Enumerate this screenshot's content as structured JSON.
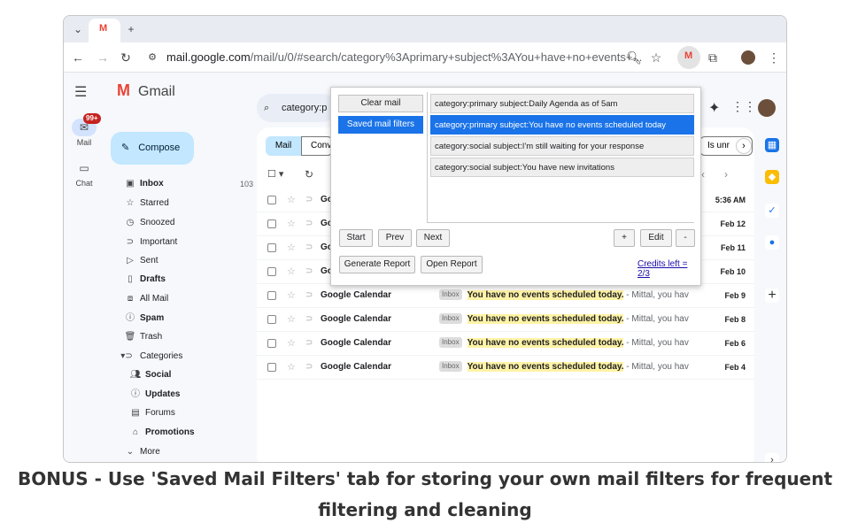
{
  "browser": {
    "url_host": "mail.google.com",
    "url_path": "/mail/u/0/#search/category%3Aprimary+subject%3AYou+have+no+events+...",
    "tab_icon_label": "M"
  },
  "app": {
    "name": "Gmail",
    "search_text": "category:p",
    "compose_label": "Compose",
    "rail": [
      {
        "label": "Mail",
        "badge": "99+"
      },
      {
        "label": "Chat"
      }
    ]
  },
  "nav": [
    {
      "label": "Inbox",
      "count": "103",
      "bold": true,
      "icon": "inbox-icon"
    },
    {
      "label": "Starred",
      "icon": "star-icon"
    },
    {
      "label": "Snoozed",
      "icon": "clock-icon"
    },
    {
      "label": "Important",
      "icon": "important-icon"
    },
    {
      "label": "Sent",
      "icon": "send-icon"
    },
    {
      "label": "Drafts",
      "bold": true,
      "icon": "draft-icon"
    },
    {
      "label": "All Mail",
      "icon": "all-mail-icon"
    },
    {
      "label": "Spam",
      "bold": true,
      "icon": "spam-icon"
    },
    {
      "label": "Trash",
      "icon": "trash-icon"
    },
    {
      "label": "Categories",
      "icon": "label-icon"
    },
    {
      "label": "Social",
      "bold": true,
      "icon": "social-icon"
    },
    {
      "label": "Updates",
      "bold": true,
      "icon": "info-icon"
    },
    {
      "label": "Forums",
      "icon": "forum-icon"
    },
    {
      "label": "Promotions",
      "bold": true,
      "icon": "tag-icon"
    },
    {
      "label": "More",
      "icon": "chevron-down-icon"
    }
  ],
  "chips": {
    "mail": "Mail",
    "conv": "Conv",
    "unread": "Is unr"
  },
  "rows": [
    {
      "sender": "Go",
      "date": "5:36 AM"
    },
    {
      "sender": "Go",
      "date": "Feb 12"
    },
    {
      "sender": "Go",
      "date": "Feb 11"
    },
    {
      "sender": "Go",
      "date": "Feb 10"
    },
    {
      "sender": "Google Calendar",
      "tag": "Inbox",
      "snippet": "- Mittal, you hav...",
      "date": "Feb 9"
    },
    {
      "sender": "Google Calendar",
      "tag": "Inbox",
      "snippet": "- Mittal, you hav...",
      "date": "Feb 8"
    },
    {
      "sender": "Google Calendar",
      "tag": "Inbox",
      "snippet": "- Mittal, you hav...",
      "date": "Feb 6"
    },
    {
      "sender": "Google Calendar",
      "tag": "Inbox",
      "snippet": "- Mittal, you hav...",
      "date": "Feb 4"
    }
  ],
  "subject_line": "You have no events scheduled today.",
  "popup": {
    "clear_label": "Clear mail",
    "saved_label": "Saved mail filters",
    "filters": [
      "category:primary subject:Daily Agenda as of 5am",
      "category:primary subject:You have no events scheduled today",
      "category:social subject:I'm still waiting for your response",
      "category:social subject:You have new invitations"
    ],
    "start": "Start",
    "prev": "Prev",
    "next": "Next",
    "plus": "+",
    "edit": "Edit",
    "minus": "-",
    "generate": "Generate Report",
    "open": "Open Report",
    "credits": "Credits left = 2/3"
  },
  "caption": "BONUS - Use 'Saved Mail Filters' tab for storing your own mail filters for frequent filtering and cleaning"
}
